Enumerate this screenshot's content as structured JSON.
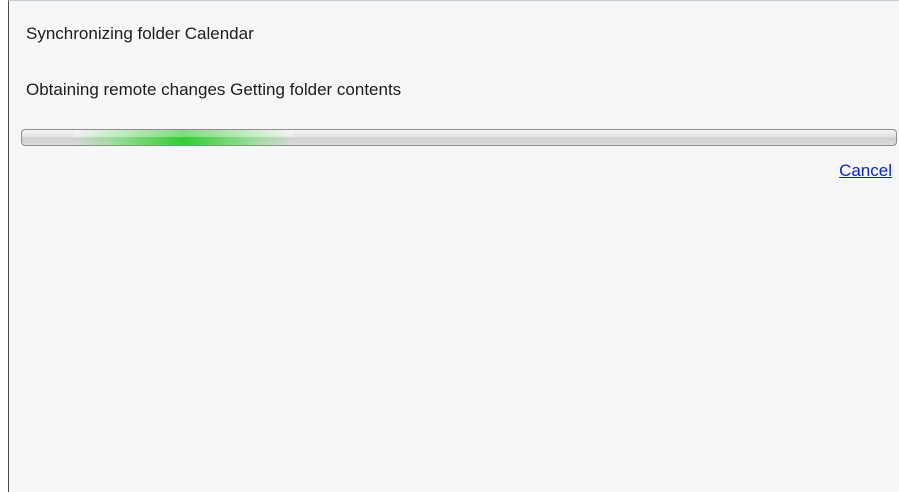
{
  "sync_dialog": {
    "title": "Synchronizing folder Calendar",
    "detail": "Obtaining remote changes Getting folder contents",
    "cancel_label": "Cancel",
    "progress": {
      "style": "indeterminate-marquee",
      "glow_start_fraction": 0.06,
      "glow_end_fraction": 0.31,
      "glow_color": "#2ecf2e"
    },
    "link_color": "#0a24cc"
  }
}
